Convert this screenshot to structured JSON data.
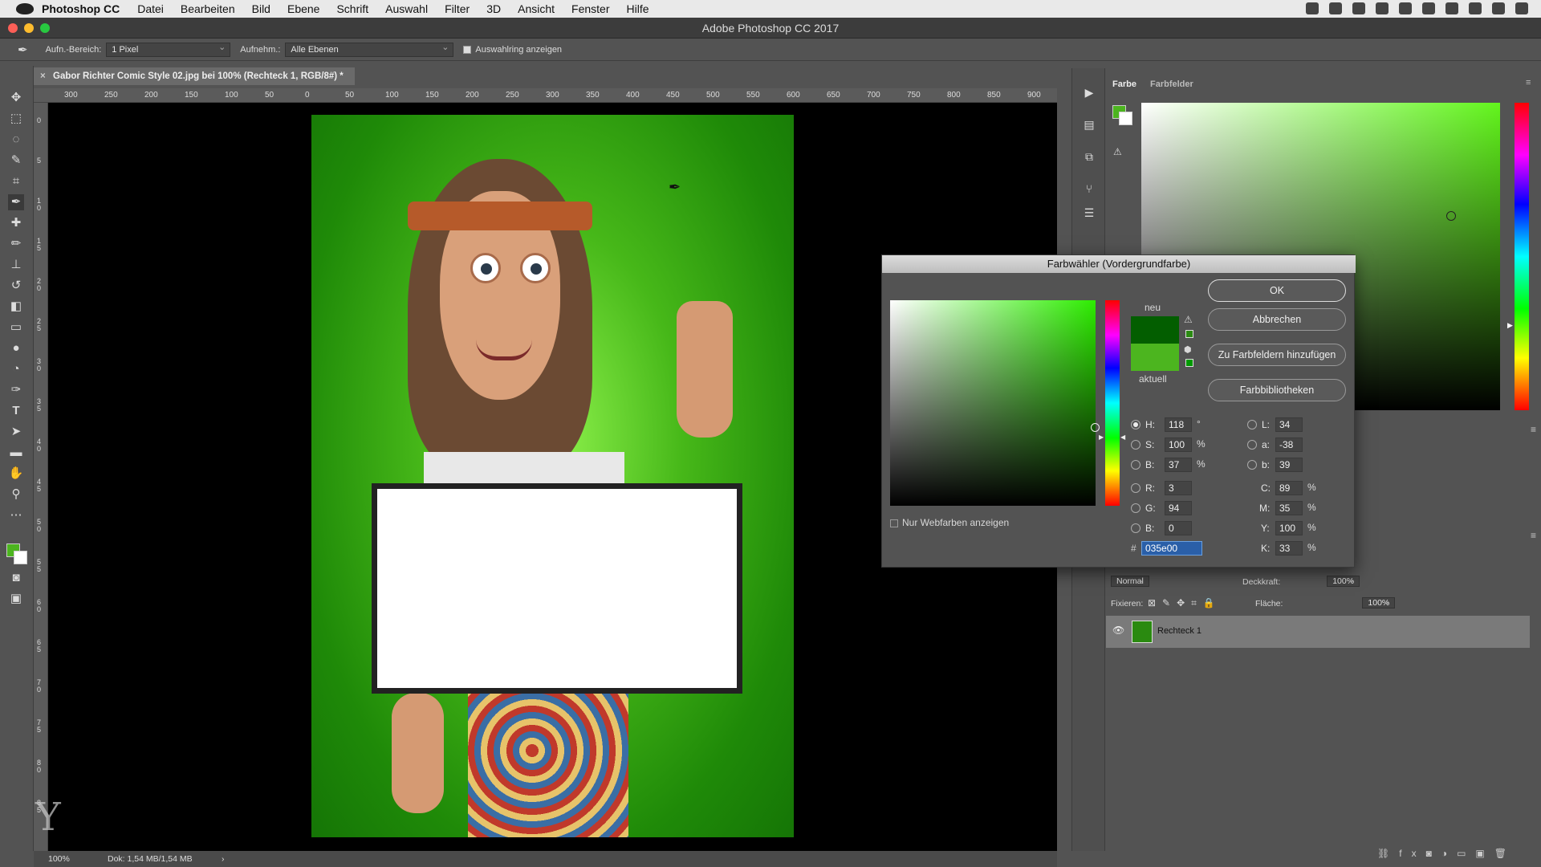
{
  "menubar": {
    "app": "Photoshop CC",
    "items": [
      "Datei",
      "Bearbeiten",
      "Bild",
      "Ebene",
      "Schrift",
      "Auswahl",
      "Filter",
      "3D",
      "Ansicht",
      "Fenster",
      "Hilfe"
    ]
  },
  "window": {
    "title": "Adobe Photoshop CC 2017"
  },
  "options": {
    "sample_size_label": "Aufn.-Bereich:",
    "sample_size_value": "1 Pixel",
    "sample_label": "Aufnehm.:",
    "sample_value": "Alle Ebenen",
    "show_ring_label": "Auswahlring anzeigen"
  },
  "document": {
    "tab": "Gabor Richter Comic Style 02.jpg bei 100% (Rechteck 1, RGB/8#) *",
    "zoom": "100%",
    "doc_info": "Dok: 1,54 MB/1,54 MB",
    "status_arrow": "›"
  },
  "ruler": {
    "h": [
      "300",
      "250",
      "200",
      "150",
      "100",
      "50",
      "0",
      "50",
      "100",
      "150",
      "200",
      "250",
      "300",
      "350",
      "400",
      "450",
      "500",
      "550",
      "600",
      "650",
      "700",
      "750",
      "800",
      "850",
      "900"
    ],
    "v": [
      "0",
      "5",
      "1 0",
      "1 5",
      "2 0",
      "2 5",
      "3 0",
      "3 5",
      "4 0",
      "4 5",
      "5 0",
      "5 5",
      "6 0",
      "6 5",
      "7 0",
      "7 5",
      "8 0",
      "8 5"
    ]
  },
  "panels": {
    "tab_color": "Farbe",
    "tab_swatches": "Farbfelder"
  },
  "picker": {
    "title": "Farbwähler (Vordergrundfarbe)",
    "ok": "OK",
    "cancel": "Abbrechen",
    "add_swatch": "Zu Farbfeldern hinzufügen",
    "libraries": "Farbbibliotheken",
    "new_label": "neu",
    "current_label": "aktuell",
    "new_color": "#035e00",
    "current_color": "#4cb51f",
    "web_only": "Nur Webfarben anzeigen",
    "H": "118",
    "S": "100",
    "B": "37",
    "R": "3",
    "G": "94",
    "Bb": "0",
    "L": "34",
    "a": "-38",
    "b": "39",
    "C": "89",
    "M": "35",
    "Y": "100",
    "K": "33",
    "hex_label": "#",
    "hex": "035e00",
    "deg": "°",
    "pct": "%",
    "lbl_H": "H:",
    "lbl_S": "S:",
    "lbl_B": "B:",
    "lbl_R": "R:",
    "lbl_G": "G:",
    "lbl_Bb": "B:",
    "lbl_L": "L:",
    "lbl_a": "a:",
    "lbl_b": "b:",
    "lbl_C": "C:",
    "lbl_M": "M:",
    "lbl_Y": "Y:",
    "lbl_K": "K:"
  },
  "layers": {
    "blend": "Normal",
    "opacity_label": "Deckkraft:",
    "opacity": "100%",
    "lock_label": "Fixieren:",
    "fill_label": "Fläche:",
    "fill": "100%",
    "layer_name": "Rechteck 1"
  },
  "colors": {
    "foreground": "#4cb51f",
    "background": "#ffffff"
  }
}
